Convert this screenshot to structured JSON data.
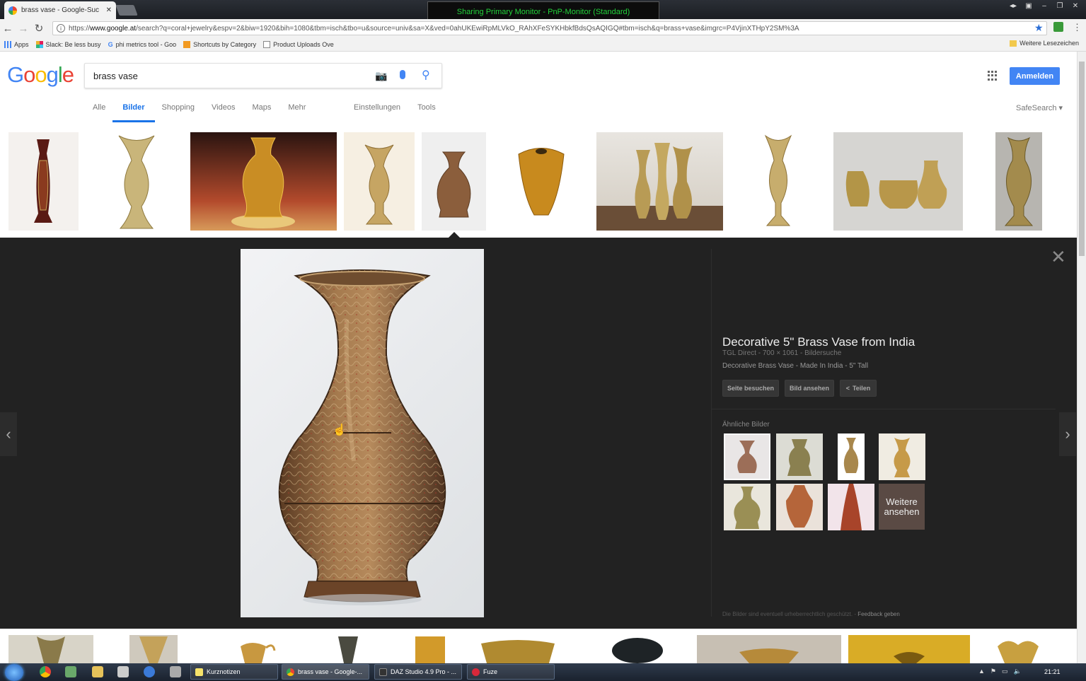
{
  "browser": {
    "tab_title": "brass vase - Google-Suc",
    "share_banner": "Sharing Primary Monitor - PnP-Monitor (Standard)",
    "url_prefix": "https://",
    "url_host": "www.google.at",
    "url_rest": "/search?q=coral+jewelry&espv=2&biw=1920&bih=1080&tbm=isch&tbo=u&source=univ&sa=X&ved=0ahUKEwiRpMLVkO_RAhXFeSYKHbkfBdsQsAQIGQ#tbm=isch&q=brass+vase&imgrc=P4VjinXTHpY2SM%3A",
    "bookmarks": [
      "Apps",
      "Slack: Be less busy",
      "phi metrics tool - Goo",
      "Shortcuts by Category",
      "Product Uploads Ove"
    ],
    "other_bookmarks": "Weitere Lesezeichen"
  },
  "google": {
    "logo": "Google",
    "query": "brass vase",
    "signin": "Anmelden",
    "tabs": [
      "Alle",
      "Bilder",
      "Shopping",
      "Videos",
      "Maps",
      "Mehr"
    ],
    "tools": [
      "Einstellungen",
      "Tools"
    ],
    "safesearch": "SafeSearch ▾"
  },
  "preview": {
    "title": "Decorative 5\" Brass Vase from India",
    "meta": "TGL Direct - 700 × 1061 - Bildersuche",
    "description": "Decorative Brass Vase - Made In India - 5\" Tall",
    "buttons": [
      "Seite besuchen",
      "Bild ansehen",
      "Teilen"
    ],
    "similar_label": "Ähnliche Bilder",
    "more_similar": "Weitere ansehen",
    "copyright": "Die Bilder sind eventuell urheberrechtlich geschützt.",
    "feedback": "Feedback geben"
  },
  "taskbar": {
    "tasks": [
      "Kurznotizen",
      "brass vase - Google-...",
      "DAZ Studio 4.9 Pro - ...",
      "Fuze"
    ],
    "clock": "21:21"
  },
  "colors": {
    "accent_blue": "#4285f4",
    "panel_bg": "#222222",
    "brass": "#c8a04a"
  }
}
